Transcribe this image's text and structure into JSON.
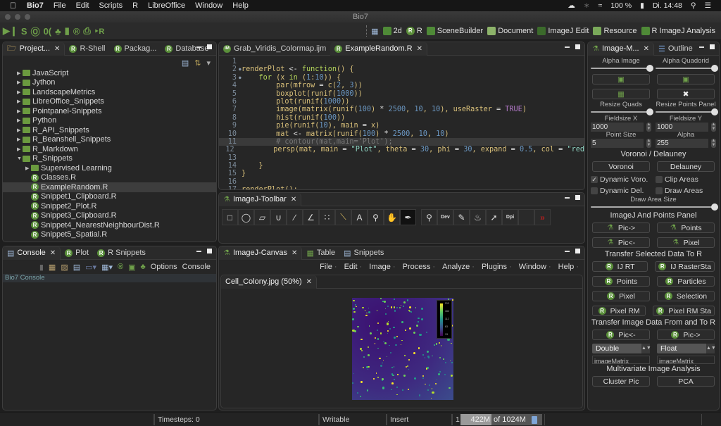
{
  "menubar": {
    "app": "Bio7",
    "items": [
      "File",
      "Edit",
      "Scripts",
      "R",
      "LibreOffice",
      "Window",
      "Help"
    ],
    "battery": "100 %",
    "clock": "Di. 14:48"
  },
  "window": {
    "title": "Bio7"
  },
  "toolbar": {
    "perspectives": [
      {
        "label": "2d",
        "icon": "grid-icon"
      },
      {
        "label": "R",
        "icon": "r-icon"
      },
      {
        "label": "SceneBuilder",
        "icon": "scenebuilder-icon"
      },
      {
        "label": "Document",
        "icon": "document-icon"
      },
      {
        "label": "ImageJ Edit",
        "icon": "imagej-edit-icon"
      },
      {
        "label": "Resource",
        "icon": "resource-icon"
      },
      {
        "label": "R ImageJ Analysis",
        "icon": "r-imagej-icon"
      }
    ]
  },
  "project_panel": {
    "tabs": [
      "Project...",
      "R-Shell",
      "Packag...",
      "Database"
    ],
    "tree": [
      {
        "label": "JavaScript",
        "type": "folder",
        "level": 1,
        "expanded": false
      },
      {
        "label": "Jython",
        "type": "folder",
        "level": 1,
        "expanded": false
      },
      {
        "label": "LandscapeMetrics",
        "type": "folder",
        "level": 1,
        "expanded": false
      },
      {
        "label": "LibreOffice_Snippets",
        "type": "folder",
        "level": 1,
        "expanded": false
      },
      {
        "label": "Pointpanel-Snippets",
        "type": "folder",
        "level": 1,
        "expanded": false
      },
      {
        "label": "Python",
        "type": "folder",
        "level": 1,
        "expanded": false
      },
      {
        "label": "R_API_Snippets",
        "type": "folder",
        "level": 1,
        "expanded": false
      },
      {
        "label": "R_Beanshell_Snippets",
        "type": "folder",
        "level": 1,
        "expanded": false
      },
      {
        "label": "R_Markdown",
        "type": "folder",
        "level": 1,
        "expanded": false
      },
      {
        "label": "R_Snippets",
        "type": "folder",
        "level": 1,
        "expanded": true
      },
      {
        "label": "Supervised Learning",
        "type": "folder",
        "level": 2,
        "expanded": false
      },
      {
        "label": "Classes.R",
        "type": "file",
        "level": 2
      },
      {
        "label": "ExampleRandom.R",
        "type": "file",
        "level": 2,
        "selected": true
      },
      {
        "label": "Snippet1_Clipboard.R",
        "type": "file",
        "level": 2
      },
      {
        "label": "Snippet2_Plot.R",
        "type": "file",
        "level": 2
      },
      {
        "label": "Snippet3_Clipboard.R",
        "type": "file",
        "level": 2
      },
      {
        "label": "Snippet4_NearestNeighbourDist.R",
        "type": "file",
        "level": 2
      },
      {
        "label": "Snippet5_Spatial.R",
        "type": "file",
        "level": 2
      }
    ]
  },
  "console_panel": {
    "tabs": [
      "Console",
      "Plot",
      "R Snippets"
    ],
    "options_label": "Options",
    "console_label": "Console",
    "console_title": "Bio7 Console"
  },
  "editor": {
    "tabs": [
      "Grab_Viridis_Colormap.ijm",
      "ExampleRandom.R"
    ],
    "active_tab": "ExampleRandom.R",
    "lines": [
      "",
      "renderPlot <- function() {",
      "    for (x in (1:10)) {",
      "        par(mfrow = c(2, 3))",
      "        boxplot(runif(1000))",
      "        plot(runif(1000))",
      "        image(matrix(runif(100) * 2500, 10, 10), useRaster = TRUE)",
      "        hist(runif(100))",
      "        pie(runif(10), main = x)",
      "        mat <- matrix(runif(100) * 2500, 10, 10)",
      "        # contour(mat,main='Plot');",
      "        persp(mat, main = \"Plot\", theta = 30, phi = 30, expand = 0.5, col = \"red",
      "",
      "    }",
      "}",
      "",
      "renderPlot();"
    ],
    "highlighted_line": 11
  },
  "imagej_toolbar": {
    "title": "ImageJ-Toolbar",
    "tools": [
      "rectangle",
      "oval",
      "polygon",
      "freehand",
      "line",
      "angle",
      "multipoint",
      "wand",
      "text",
      "magnifier",
      "hand",
      "color-picker",
      "zoom",
      "dev",
      "brush",
      "flood-fill",
      "arrow",
      "dpi",
      "empty",
      "more"
    ]
  },
  "canvas_panel": {
    "tabs": [
      "ImageJ-Canvas",
      "Table",
      "Snippets"
    ],
    "menu": [
      "File",
      "Edit",
      "Image",
      "Process",
      "Analyze",
      "Plugins",
      "Window",
      "Help"
    ],
    "image_tab": "Cell_Colony.jpg (50%)",
    "colorbar_ticks": [
      "212",
      "162",
      "112",
      "63",
      "13"
    ]
  },
  "image_methods": {
    "tabs": [
      "Image-M...",
      "Outline"
    ],
    "alpha_image_label": "Alpha Image",
    "alpha_image_value": 1.0,
    "alpha_quadorid_label": "Alpha Quadorid",
    "alpha_quadorid_value": 1.0,
    "resize_quads_label": "Resize Quads",
    "resize_quads_value": 1.0,
    "resize_points_label": "Resize Points Panel",
    "resize_points_value": 1.0,
    "fieldsize_x_label": "Fieldsize X",
    "fieldsize_x": "1000",
    "fieldsize_y_label": "Fieldsize Y",
    "fieldsize_y": "1000",
    "point_size_label": "Point Size",
    "point_size": "5",
    "alpha_label": "Alpha",
    "alpha": "255",
    "voronoi_heading": "Voronoi / Delauney",
    "voronoi_btn": "Voronoi",
    "delauney_btn": "Delauney",
    "dynamic_voro": {
      "label": "Dynamic Voro.",
      "checked": true
    },
    "clip_areas": {
      "label": "Clip Areas",
      "checked": false
    },
    "dynamic_del": {
      "label": "Dynamic Del.",
      "checked": false
    },
    "draw_areas": {
      "label": "Draw Areas",
      "checked": false
    },
    "draw_area_size_label": "Draw Area Size",
    "draw_area_size_value": 1.0,
    "ij_points_heading": "ImageJ And Points Panel",
    "pic_to": "Pic->",
    "points": "Points",
    "pic_from": "Pic<-",
    "pixel": "Pixel",
    "transfer_selected_heading": "Transfer Selected Data To R",
    "ij_rt": "IJ RT",
    "ij_rasterstats": "IJ RasterSta",
    "points_r": "Points",
    "particles": "Particles",
    "pixel_r": "Pixel",
    "selection": "Selection",
    "pixel_rm": "Pixel RM",
    "pixel_rm_stats": "Pixel RM Sta",
    "transfer_image_heading": "Transfer Image Data From and To R",
    "pic_from_r": "Pic<-",
    "pic_to_r": "Pic->",
    "type_left": "Double",
    "type_right": "Float",
    "matrix_left": "imageMatrix",
    "matrix_right": "imageMatrix",
    "multivariate_heading": "Multivariate Image Analysis",
    "cluster_pic": "Cluster Pic",
    "pca": "PCA"
  },
  "statusbar": {
    "timesteps": "Timesteps: 0",
    "writable": "Writable",
    "insert": "Insert",
    "position": "1",
    "memory_used": "422M",
    "memory_total": "of 1024M"
  }
}
